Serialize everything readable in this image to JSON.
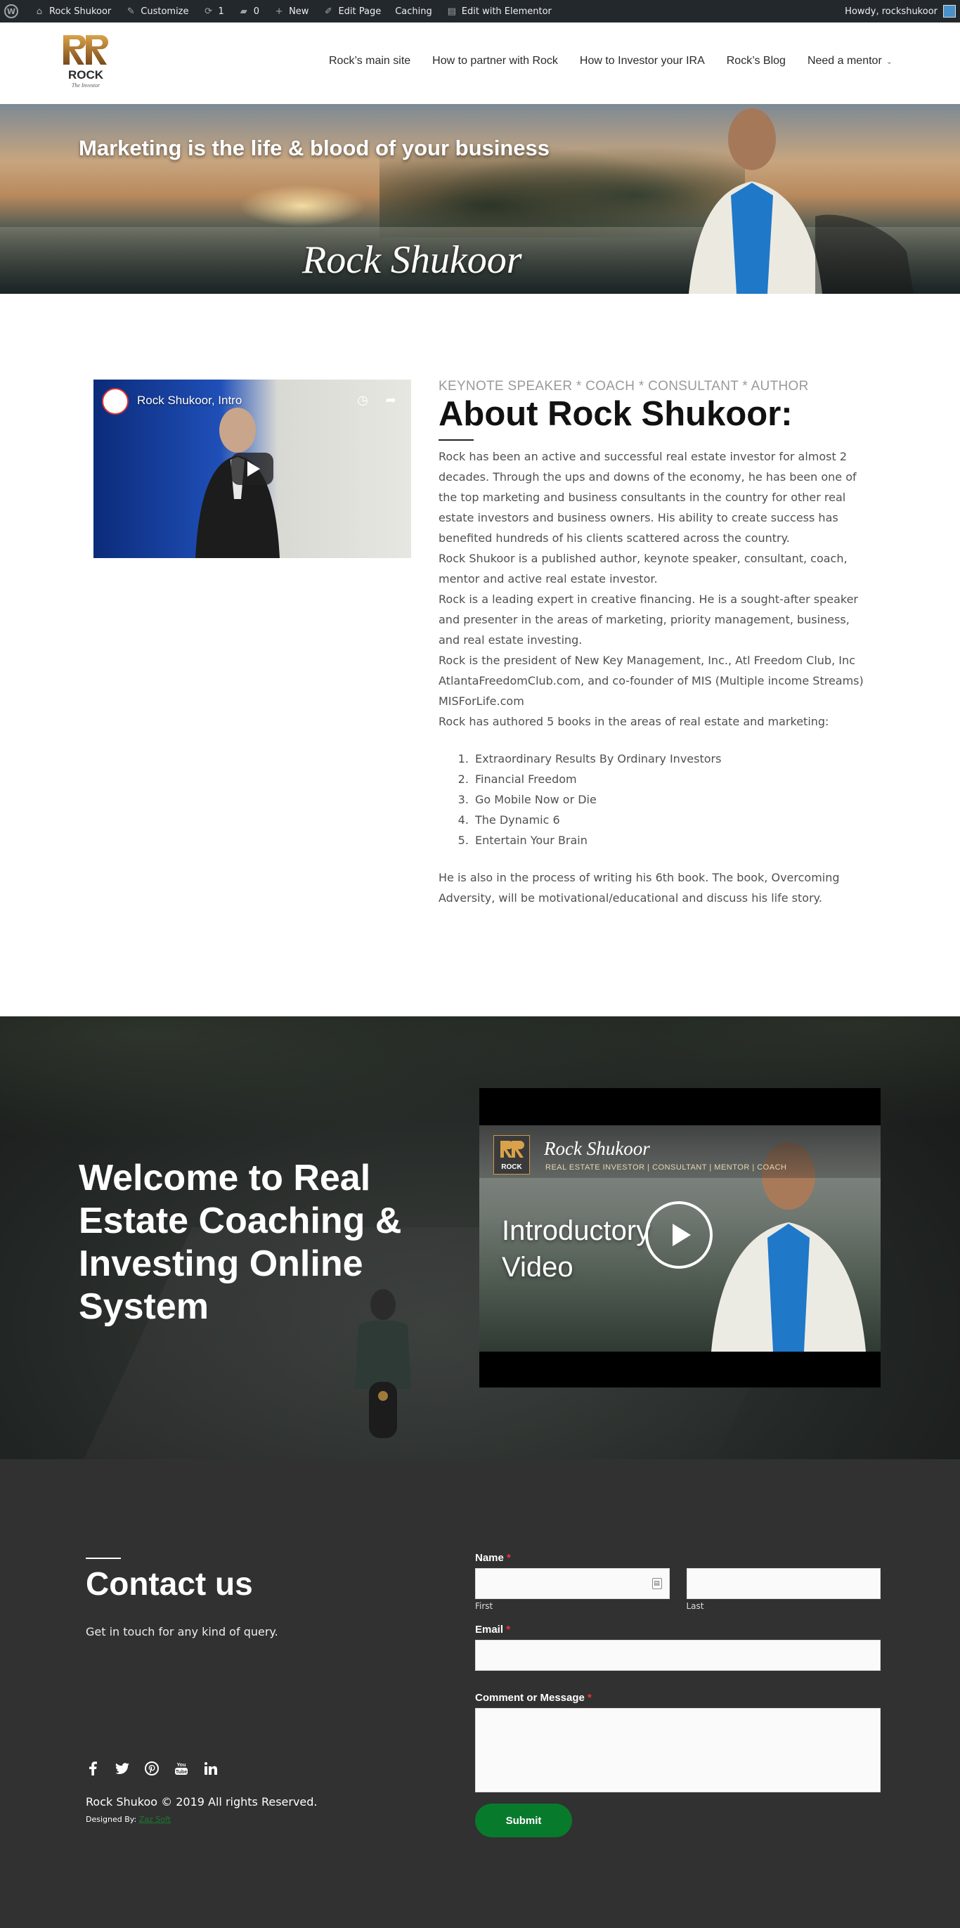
{
  "adminbar": {
    "site_name": "Rock Shukoor",
    "customize": "Customize",
    "updates_count": "1",
    "comments_count": "0",
    "new_label": "New",
    "edit_page": "Edit Page",
    "caching": "Caching",
    "elementor": "Edit with Elementor",
    "howdy": "Howdy, rockshukoor"
  },
  "logo": {
    "wordmark": "ROCK",
    "tagline": "The Investor"
  },
  "nav": {
    "items": [
      "Rock’s main site",
      "How to partner with Rock",
      "How to Investor your IRA",
      "Rock’s Blog",
      "Need a mentor"
    ]
  },
  "hero": {
    "tagline": "Marketing is the life & blood of your business",
    "name": "Rock Shukoor"
  },
  "about": {
    "video_title": "Rock Shukoor, Intro",
    "eyebrow": "KEYNOTE SPEAKER * COACH * CONSULTANT * AUTHOR",
    "title": "About Rock Shukoor:",
    "paragraphs": [
      "Rock has been an active and successful real estate investor for almost 2 decades. Through the ups and downs of the economy, he has been one of the top marketing and business consultants in the country for other real estate investors and business owners. His ability to create success has benefited hundreds of his clients scattered across the country.",
      "Rock Shukoor is a published author, keynote speaker, consultant, coach, mentor and active real estate investor.",
      "Rock is a leading expert in creative financing. He is a sought-after speaker and presenter in the areas of marketing, priority management, business, and real estate investing.",
      "Rock is the president of New Key Management, Inc., Atl Freedom Club, Inc AtlantaFreedomClub.com, and co-founder of MIS (Multiple income Streams) MISForLife.com",
      "Rock has authored 5 books in the areas of real estate and marketing:"
    ],
    "books": [
      "Extraordinary Results By Ordinary Investors",
      "Financial Freedom",
      "Go Mobile Now or Die",
      "The Dynamic 6",
      "Entertain Your Brain"
    ],
    "closing": "He is also in the process of writing his 6th book. The book, Overcoming Adversity, will be motivational/educational and discuss his life story."
  },
  "welcome": {
    "title": "Welcome to Real Estate Coaching & Investing Online System",
    "video_name": "Rock Shukoor",
    "video_sub": "REAL ESTATE INVESTOR | CONSULTANT | MENTOR | COACH",
    "video_caption": "Introductory Video"
  },
  "contact": {
    "title": "Contact us",
    "subtitle": "Get in touch for any kind of query.",
    "copyright": "Rock Shukoo © 2019 All rights Reserved.",
    "designed_by": "Designed By:",
    "designer": "Zaz Soft",
    "form": {
      "name_label": "Name",
      "first_label": "First",
      "last_label": "Last",
      "email_label": "Email",
      "message_label": "Comment or Message",
      "required_mark": "*",
      "submit_label": "Submit"
    }
  },
  "colors": {
    "accent_green": "#087a2c",
    "required_red": "#e33333",
    "admin_bar": "#23282d",
    "footer_bg": "#313131"
  }
}
